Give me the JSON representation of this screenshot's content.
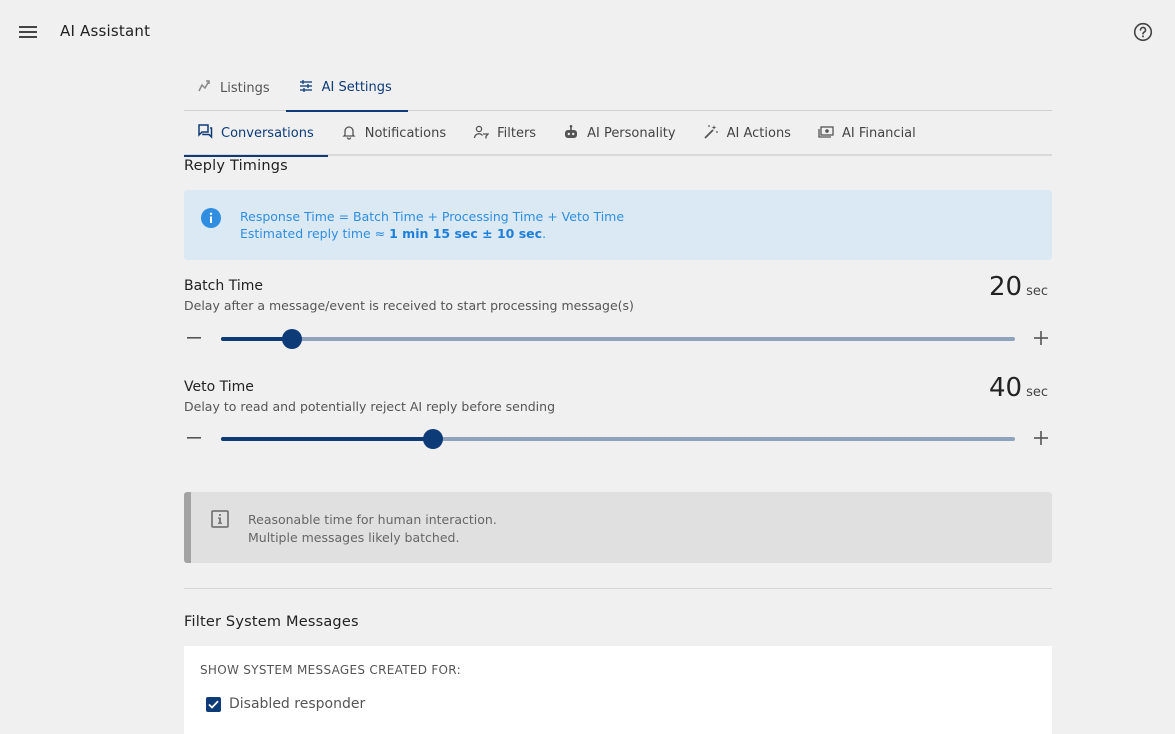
{
  "app": {
    "title": "AI Assistant"
  },
  "tabs_top": [
    {
      "label": "Listings",
      "icon": "listings-icon"
    },
    {
      "label": "AI Settings",
      "icon": "tune-icon",
      "active": true
    }
  ],
  "tabs_sub": [
    {
      "label": "Conversations",
      "icon": "chat-icon",
      "active": true
    },
    {
      "label": "Notifications",
      "icon": "bell-icon"
    },
    {
      "label": "Filters",
      "icon": "person-filter-icon"
    },
    {
      "label": "AI Personality",
      "icon": "robot-icon"
    },
    {
      "label": "AI Actions",
      "icon": "magic-wand-icon"
    },
    {
      "label": "AI Financial",
      "icon": "money-icon"
    }
  ],
  "reply_timings": {
    "title": "Reply Timings",
    "info_line1": "Response Time = Batch Time + Processing Time + Veto Time",
    "info_line2_prefix": "Estimated reply time ≈ ",
    "info_line2_bold": "1 min 15 sec ± 10 sec",
    "info_line2_suffix": "."
  },
  "batch_time": {
    "label": "Batch Time",
    "description": "Delay after a message/event is received to start processing message(s)",
    "value": "20",
    "unit": "sec",
    "fraction": 0.09
  },
  "veto_time": {
    "label": "Veto Time",
    "description": "Delay to read and potentially reject AI reply before sending",
    "value": "40",
    "unit": "sec",
    "fraction": 0.267
  },
  "note": {
    "line1": "Reasonable time for human interaction.",
    "line2": "Multiple messages likely batched."
  },
  "filter_system": {
    "title": "Filter System Messages",
    "caption": "SHOW SYSTEM MESSAGES CREATED FOR:",
    "checkbox_label": "Disabled responder",
    "checked": true
  },
  "colors": {
    "primary": "#0d3b78",
    "info_text": "#2f8ee0",
    "info_bg": "#dbe9f4",
    "track": "#8fa3bc"
  }
}
